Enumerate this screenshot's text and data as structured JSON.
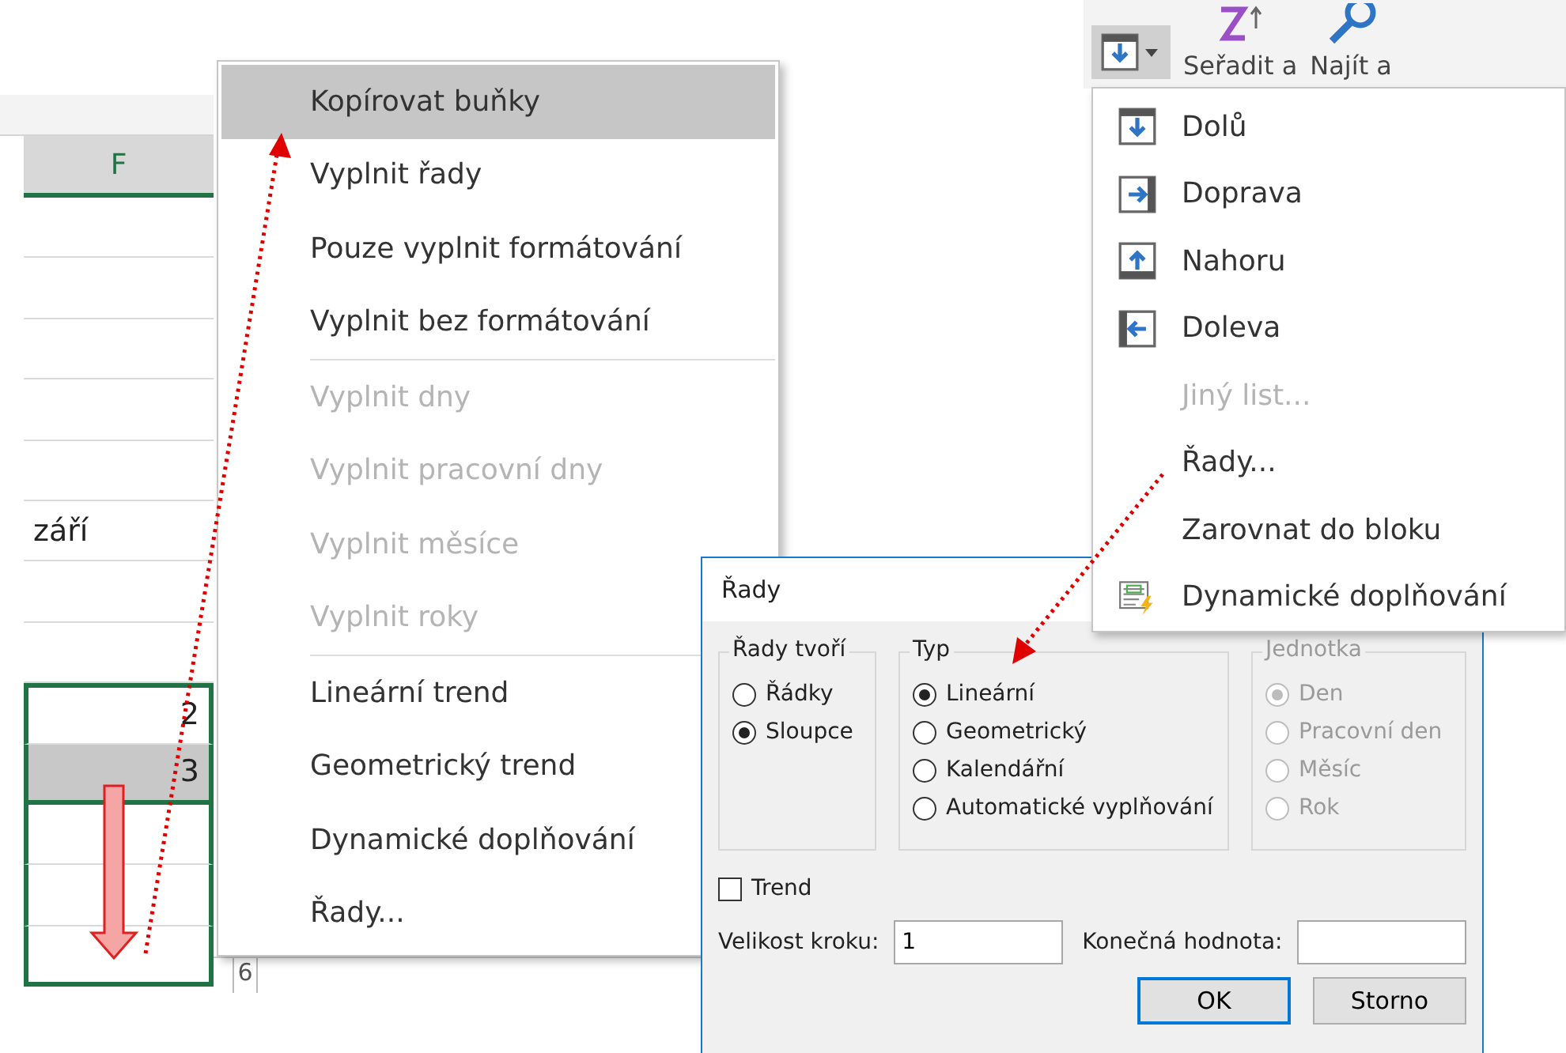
{
  "sheet": {
    "column_header": "F",
    "rows": [
      {
        "selected": false,
        "highlighted": false
      },
      {
        "selected": false,
        "highlighted": false
      },
      {
        "selected": false,
        "highlighted": false
      },
      {
        "selected": false,
        "highlighted": false
      },
      {
        "selected": false,
        "highlighted": false
      },
      {
        "value": "září",
        "kind": "text",
        "selected": false,
        "highlighted": false
      },
      {
        "selected": false,
        "highlighted": false
      },
      {
        "selected": false,
        "highlighted": false
      },
      {
        "value": "2",
        "kind": "number",
        "selected": true,
        "highlighted": false
      },
      {
        "value": "3",
        "kind": "number",
        "selected": true,
        "highlighted": true
      },
      {
        "selected": true,
        "highlighted": false
      },
      {
        "selected": true,
        "highlighted": false
      },
      {
        "selected": true,
        "highlighted": false
      }
    ],
    "row_number": "6"
  },
  "context_menu": {
    "items": [
      {
        "kind": "item",
        "label": "Kopírovat buňky",
        "disabled": false,
        "highlighted": true
      },
      {
        "kind": "item",
        "label": "Vyplnit řady",
        "disabled": false,
        "highlighted": false
      },
      {
        "kind": "item",
        "label": "Pouze vyplnit formátování",
        "disabled": false,
        "highlighted": false
      },
      {
        "kind": "item",
        "label": "Vyplnit bez formátování",
        "disabled": false,
        "highlighted": false
      },
      {
        "kind": "separator"
      },
      {
        "kind": "item",
        "label": "Vyplnit dny",
        "disabled": true,
        "highlighted": false
      },
      {
        "kind": "item",
        "label": "Vyplnit pracovní dny",
        "disabled": true,
        "highlighted": false
      },
      {
        "kind": "item",
        "label": "Vyplnit měsíce",
        "disabled": true,
        "highlighted": false
      },
      {
        "kind": "item",
        "label": "Vyplnit roky",
        "disabled": true,
        "highlighted": false
      },
      {
        "kind": "separator"
      },
      {
        "kind": "item",
        "label": "Lineární trend",
        "disabled": false,
        "highlighted": false
      },
      {
        "kind": "item",
        "label": "Geometrický trend",
        "disabled": false,
        "highlighted": false
      },
      {
        "kind": "item",
        "label": "Dynamické doplňování",
        "disabled": false,
        "highlighted": false
      },
      {
        "kind": "item",
        "label": "Řady...",
        "disabled": false,
        "highlighted": false
      }
    ]
  },
  "ribbon": {
    "sort_label": "Seřadit a",
    "find_label": "Najít a"
  },
  "fill_menu": {
    "items": [
      {
        "label": "Dolů",
        "kind": "down",
        "disabled": false
      },
      {
        "label": "Doprava",
        "kind": "right",
        "disabled": false
      },
      {
        "label": "Nahoru",
        "kind": "up",
        "disabled": false
      },
      {
        "label": "Doleva",
        "kind": "left",
        "disabled": false
      },
      {
        "label": "Jiný list...",
        "kind": "plain",
        "disabled": true
      },
      {
        "label": "Řady...",
        "kind": "plain",
        "disabled": false
      },
      {
        "label": "Zarovnat do bloku",
        "kind": "plain",
        "disabled": false
      },
      {
        "label": "Dynamické doplňování",
        "kind": "flash",
        "disabled": false
      }
    ]
  },
  "dialog": {
    "title": "Řady",
    "groups": [
      {
        "title": "Řady tvoří",
        "disabled": false,
        "options": [
          {
            "label": "Řádky",
            "selected": false
          },
          {
            "label": "Sloupce",
            "selected": true
          }
        ]
      },
      {
        "title": "Typ",
        "disabled": false,
        "options": [
          {
            "label": "Lineární",
            "selected": true
          },
          {
            "label": "Geometrický",
            "selected": false
          },
          {
            "label": "Kalendářní",
            "selected": false
          },
          {
            "label": "Automatické vyplňování",
            "selected": false
          }
        ]
      },
      {
        "title": "Jednotka",
        "disabled": true,
        "options": [
          {
            "label": "Den",
            "selected": true
          },
          {
            "label": "Pracovní den",
            "selected": false
          },
          {
            "label": "Měsíc",
            "selected": false
          },
          {
            "label": "Rok",
            "selected": false
          }
        ]
      }
    ],
    "trend": {
      "label": "Trend",
      "checked": false
    },
    "step": {
      "label": "Velikost kroku:",
      "value": "1"
    },
    "stop": {
      "label": "Konečná hodnota:"
    },
    "buttons": [
      {
        "label": "OK",
        "default": true
      },
      {
        "label": "Storno",
        "default": false
      }
    ]
  }
}
